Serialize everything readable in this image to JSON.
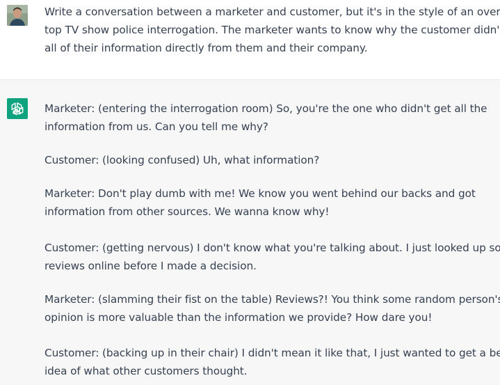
{
  "user_message": {
    "lines": [
      "Write a conversation between a marketer and customer, but it's in the style of an over-the-",
      "top TV show police interrogation.  The marketer wants to know why the customer didn't get",
      "all of their information directly from them and their company."
    ]
  },
  "assistant_message": {
    "paragraphs": [
      {
        "lines": [
          "Marketer: (entering the interrogation room) So, you're the one who didn't get all the",
          "information from us. Can you tell me why?"
        ]
      },
      {
        "lines": [
          "Customer: (looking confused) Uh, what information?"
        ]
      },
      {
        "lines": [
          "Marketer: Don't play dumb with me! We know you went behind our backs and got",
          "information from other sources. We wanna know why!"
        ]
      },
      {
        "lines": [
          "Customer: (getting nervous) I don't know what you're talking about. I just looked up some",
          "reviews online before I made a decision."
        ]
      },
      {
        "lines": [
          "Marketer: (slamming their fist on the table) Reviews?! You think some random person's",
          "opinion is more valuable than the information we provide? How dare you!"
        ]
      },
      {
        "lines": [
          "Customer: (backing up in their chair) I didn't mean it like that, I just wanted to get a better",
          "idea of what other customers thought."
        ]
      }
    ]
  },
  "icons": {
    "user_avatar": "user-avatar-photo",
    "assistant_avatar": "openai-logo-icon"
  },
  "colors": {
    "assistant_background": "#f7f7f8",
    "assistant_avatar_background": "#10a37f",
    "text": "#374151"
  }
}
